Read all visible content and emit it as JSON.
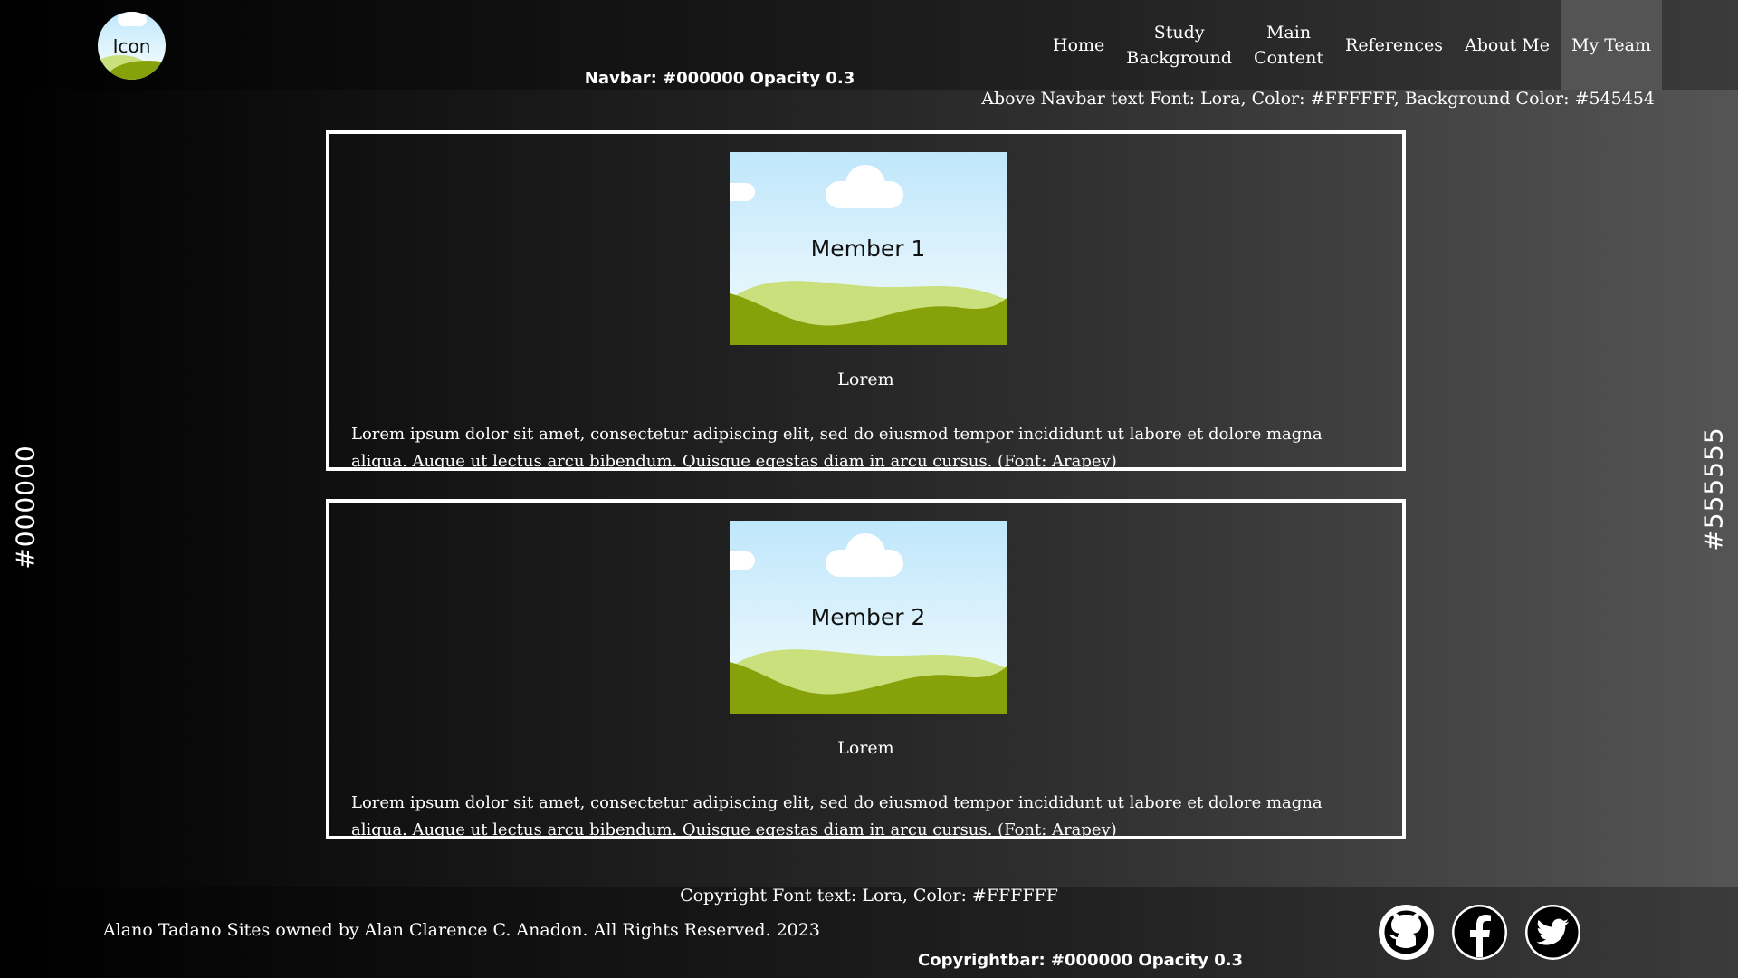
{
  "navbar": {
    "logo_label": "Icon",
    "note": "Navbar: #000000 Opacity 0.3",
    "links": [
      {
        "label": "Home"
      },
      {
        "label": "Study\nBackground"
      },
      {
        "label": "Main\nContent"
      },
      {
        "label": "References"
      },
      {
        "label": "About Me"
      },
      {
        "label": "My Team"
      }
    ],
    "active": "My Team",
    "above_note": "Above Navbar text Font: Lora, Color: #FFFFFF, Background Color: #545454"
  },
  "side": {
    "left_label": "#000000",
    "right_label": "#555555"
  },
  "members": [
    {
      "image_label": "Member 1",
      "title": "Lorem",
      "description": "Lorem ipsum dolor sit amet, consectetur adipiscing elit, sed do eiusmod tempor incididunt ut labore et dolore magna aliqua. Augue ut lectus arcu bibendum. Quisque egestas diam in arcu cursus. (Font: Arapey)"
    },
    {
      "image_label": "Member 2",
      "title": "Lorem",
      "description": "Lorem ipsum dolor sit amet, consectetur adipiscing elit, sed do eiusmod tempor incididunt ut labore et dolore magna aliqua. Augue ut lectus arcu bibendum. Quisque egestas diam in arcu cursus. (Font: Arapey)"
    }
  ],
  "footer": {
    "copyright_note": "Copyright Font text: Lora, Color: #FFFFFF",
    "copyright_text": "Alano Tadano Sites owned by Alan Clarence C. Anadon. All Rights Reserved. 2023",
    "bar_note": "Copyrightbar: #000000 Opacity 0.3",
    "social": [
      {
        "icon": "github-icon"
      },
      {
        "icon": "facebook-icon"
      },
      {
        "icon": "twitter-icon"
      }
    ]
  },
  "colors": {
    "gradient_left": "#000000",
    "gradient_right": "#555555",
    "active_nav_bg": "#545454",
    "text": "#FFFFFF",
    "hill_light": "#c9e07c",
    "hill_dark": "#86a10a",
    "sky": "#bfe7fb"
  }
}
